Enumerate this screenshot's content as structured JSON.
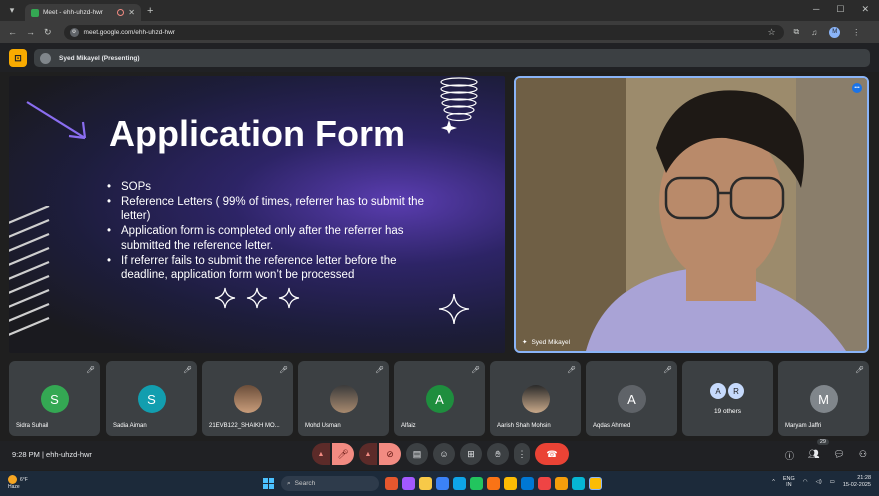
{
  "browser": {
    "tab_title": "Meet - ehh-uhzd-hwr",
    "new_tab": "+",
    "window_controls": {
      "minimize": "─",
      "maximize": "☐",
      "close": "✕"
    },
    "url": "meet.google.com/ehh-uhzd-hwr",
    "profile_initial": "M"
  },
  "meet": {
    "presenting_label": "Syed Mikayel (Presenting)"
  },
  "slide": {
    "title": "Application Form",
    "bullets": [
      "SOPs",
      "Reference Letters ( 99% of times, referrer has to submit the letter)",
      "Application form is completed only after the referrer has submitted the reference letter.",
      "If referrer fails to submit the reference letter before the deadline, application form won’t be processed"
    ]
  },
  "speaker": {
    "name": "Syed Mikayel"
  },
  "participants": [
    {
      "name": "Sidra Suhail",
      "initial": "S",
      "color": "#34a853",
      "photo": false
    },
    {
      "name": "Sadia Aiman",
      "initial": "S",
      "color": "#129eaf",
      "photo": false
    },
    {
      "name": "21EVB122_SHAIKH MO...",
      "initial": "",
      "color": "",
      "photo": true
    },
    {
      "name": "Mohd Usman",
      "initial": "",
      "color": "",
      "photo": true
    },
    {
      "name": "Alfaiz",
      "initial": "A",
      "color": "#1e8e3e",
      "photo": false
    },
    {
      "name": "Aarish Shah Mohsin",
      "initial": "",
      "color": "",
      "photo": true
    },
    {
      "name": "Aqdas Ahmed",
      "initial": "A",
      "color": "#5f6368",
      "photo": false
    },
    {
      "name": "19 others",
      "initial": "",
      "color": "",
      "photo": false,
      "others": [
        "A",
        "R"
      ]
    },
    {
      "name": "Maryam Jaffri",
      "initial": "M",
      "color": "#80868b",
      "photo": false
    }
  ],
  "controlbar": {
    "meeting_info": "9:28 PM  |  ehh-uhzd-hwr",
    "participant_count": "29"
  },
  "taskbar": {
    "weather_temp": "6°F",
    "weather_desc": "Haze",
    "search_placeholder": "Search",
    "lang_top": "ENG",
    "lang_bottom": "IN",
    "time": "21:28",
    "date": "15-02-2025"
  }
}
